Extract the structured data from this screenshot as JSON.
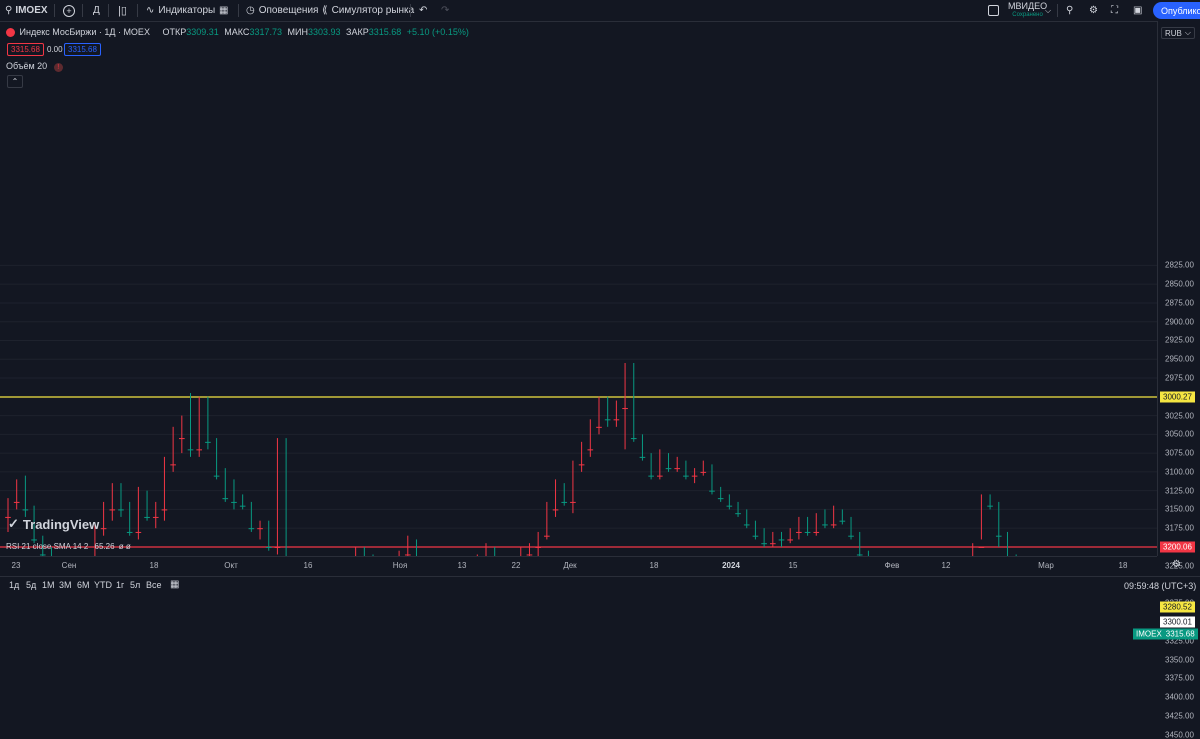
{
  "toolbar": {
    "symbol": "IMOEX",
    "interval": "Д",
    "indicators_label": "Индикаторы",
    "alerts_label": "Оповещения",
    "replay_label": "Симулятор рынка",
    "layout_name": "МВИДЕО",
    "layout_status": "Сохранено",
    "publish_label": "Опубликов"
  },
  "legend": {
    "title": "Индекс МосБиржи · 1Д · MOEX",
    "open_label": "ОТКР",
    "open": "3309.31",
    "high_label": "МАКС",
    "high": "3317.73",
    "low_label": "МИН",
    "low": "3303.93",
    "close_label": "ЗАКР",
    "close": "3315.68",
    "change": "+5.10 (+0.15%)",
    "bid": "3315.68",
    "spread": "0.00",
    "ask": "3315.68",
    "volume_label": "Объём 20"
  },
  "currency": "RUB",
  "price_axis": [
    "3450.00",
    "3425.00",
    "3400.00",
    "3375.00",
    "3350.00",
    "3325.00",
    "3275.00",
    "3250.00",
    "3225.00",
    "3175.00",
    "3150.00",
    "3125.00",
    "3100.00",
    "3075.00",
    "3050.00",
    "3025.00",
    "2975.00",
    "2950.00",
    "2925.00",
    "2900.00",
    "2875.00",
    "2850.00",
    "2825.00"
  ],
  "time_axis": [
    "23",
    "Сен",
    "18",
    "Окт",
    "16",
    "Ноя",
    "13",
    "22",
    "Дек",
    "18",
    "2024",
    "15",
    "Фев",
    "12",
    "Мар",
    "18"
  ],
  "levels": [
    {
      "value": "3300.01",
      "color": "#ffffff"
    },
    {
      "value": "3280.52",
      "color": "#f5e642"
    },
    {
      "value": "3200.06",
      "color": "#f23645"
    },
    {
      "value": "3000.27",
      "color": "#f5e642"
    }
  ],
  "last_price": {
    "symbol": "IMOEX",
    "value": "3315.68",
    "color": "#089981"
  },
  "watermark": "TradingView",
  "rsi": {
    "label": "RSI 21 close SMA 14 2",
    "value": "65.26",
    "extra": "ø ø"
  },
  "timeframes": [
    "1д",
    "5д",
    "1M",
    "3M",
    "6M",
    "YTD",
    "1г",
    "5л",
    "Все"
  ],
  "clock": "09:59:48 (UTC+3)",
  "colors": {
    "up": "#089981",
    "down": "#f23645",
    "background": "#131722",
    "accent": "#2962ff"
  },
  "chart_data": {
    "type": "candlestick",
    "unit": "RUB",
    "ylim": [
      2810,
      3480
    ],
    "candles": [
      [
        3160,
        3180,
        3135,
        3140
      ],
      [
        3140,
        3150,
        3110,
        3115
      ],
      [
        3115,
        3160,
        3105,
        3150
      ],
      [
        3150,
        3195,
        3145,
        3190
      ],
      [
        3190,
        3215,
        3185,
        3210
      ],
      [
        3210,
        3225,
        3200,
        3220
      ],
      [
        3220,
        3235,
        3215,
        3230
      ],
      [
        3230,
        3275,
        3225,
        3270
      ],
      [
        3270,
        3285,
        3245,
        3255
      ],
      [
        3255,
        3270,
        3240,
        3260
      ],
      [
        3260,
        3265,
        3170,
        3175
      ],
      [
        3175,
        3185,
        3140,
        3150
      ],
      [
        3150,
        3165,
        3115,
        3125
      ],
      [
        3125,
        3160,
        3115,
        3150
      ],
      [
        3150,
        3185,
        3140,
        3180
      ],
      [
        3180,
        3190,
        3120,
        3130
      ],
      [
        3130,
        3165,
        3125,
        3160
      ],
      [
        3160,
        3175,
        3140,
        3150
      ],
      [
        3150,
        3165,
        3080,
        3090
      ],
      [
        3090,
        3100,
        3040,
        3055
      ],
      [
        3055,
        3075,
        3025,
        3030
      ],
      [
        3030,
        3080,
        2995,
        3070
      ],
      [
        3070,
        3080,
        3000,
        3010
      ],
      [
        3010,
        3070,
        3000,
        3060
      ],
      [
        3060,
        3110,
        3055,
        3105
      ],
      [
        3105,
        3140,
        3095,
        3135
      ],
      [
        3135,
        3150,
        3110,
        3140
      ],
      [
        3140,
        3150,
        3130,
        3145
      ],
      [
        3145,
        3180,
        3140,
        3175
      ],
      [
        3175,
        3190,
        3165,
        3170
      ],
      [
        3170,
        3205,
        3165,
        3200
      ],
      [
        3200,
        3210,
        3055,
        3060
      ],
      [
        3060,
        3235,
        3055,
        3225
      ],
      [
        3225,
        3250,
        3215,
        3245
      ],
      [
        3245,
        3260,
        3235,
        3255
      ],
      [
        3255,
        3265,
        3245,
        3250
      ],
      [
        3250,
        3275,
        3245,
        3270
      ],
      [
        3270,
        3280,
        3255,
        3265
      ],
      [
        3265,
        3275,
        3250,
        3260
      ],
      [
        3260,
        3270,
        3240,
        3245
      ],
      [
        3245,
        3250,
        3200,
        3210
      ],
      [
        3210,
        3225,
        3200,
        3220
      ],
      [
        3220,
        3235,
        3210,
        3230
      ],
      [
        3230,
        3245,
        3225,
        3240
      ],
      [
        3240,
        3250,
        3230,
        3235
      ],
      [
        3235,
        3245,
        3205,
        3210
      ],
      [
        3210,
        3215,
        3185,
        3195
      ],
      [
        3195,
        3230,
        3190,
        3225
      ],
      [
        3225,
        3250,
        3220,
        3245
      ],
      [
        3245,
        3255,
        3240,
        3250
      ],
      [
        3250,
        3265,
        3240,
        3245
      ],
      [
        3245,
        3260,
        3235,
        3255
      ],
      [
        3255,
        3265,
        3245,
        3250
      ],
      [
        3250,
        3260,
        3225,
        3230
      ],
      [
        3230,
        3240,
        3210,
        3215
      ],
      [
        3215,
        3225,
        3195,
        3205
      ],
      [
        3205,
        3235,
        3200,
        3230
      ],
      [
        3230,
        3245,
        3225,
        3240
      ],
      [
        3240,
        3245,
        3220,
        3225
      ],
      [
        3225,
        3235,
        3200,
        3210
      ],
      [
        3210,
        3225,
        3195,
        3200
      ],
      [
        3200,
        3215,
        3180,
        3185
      ],
      [
        3185,
        3190,
        3140,
        3150
      ],
      [
        3150,
        3160,
        3110,
        3120
      ],
      [
        3120,
        3145,
        3115,
        3140
      ],
      [
        3140,
        3155,
        3085,
        3090
      ],
      [
        3090,
        3100,
        3060,
        3070
      ],
      [
        3070,
        3080,
        3030,
        3040
      ],
      [
        3040,
        3050,
        3000,
        3010
      ],
      [
        3010,
        3040,
        3000,
        3030
      ],
      [
        3030,
        3040,
        3005,
        3015
      ],
      [
        3015,
        3070,
        2955,
        2960
      ],
      [
        2960,
        3060,
        2955,
        3055
      ],
      [
        3055,
        3085,
        3050,
        3080
      ],
      [
        3080,
        3110,
        3075,
        3105
      ],
      [
        3105,
        3110,
        3070,
        3080
      ],
      [
        3080,
        3100,
        3075,
        3095
      ],
      [
        3095,
        3100,
        3080,
        3090
      ],
      [
        3090,
        3110,
        3085,
        3105
      ],
      [
        3105,
        3115,
        3095,
        3100
      ],
      [
        3100,
        3105,
        3085,
        3095
      ],
      [
        3095,
        3130,
        3090,
        3125
      ],
      [
        3125,
        3140,
        3120,
        3135
      ],
      [
        3135,
        3150,
        3130,
        3145
      ],
      [
        3145,
        3160,
        3140,
        3155
      ],
      [
        3155,
        3175,
        3150,
        3170
      ],
      [
        3170,
        3190,
        3165,
        3185
      ],
      [
        3185,
        3200,
        3175,
        3195
      ],
      [
        3195,
        3200,
        3180,
        3185
      ],
      [
        3185,
        3200,
        3180,
        3190
      ],
      [
        3190,
        3195,
        3175,
        3180
      ],
      [
        3180,
        3190,
        3160,
        3165
      ],
      [
        3165,
        3185,
        3160,
        3180
      ],
      [
        3180,
        3185,
        3155,
        3160
      ],
      [
        3160,
        3175,
        3150,
        3170
      ],
      [
        3170,
        3175,
        3145,
        3155
      ],
      [
        3155,
        3170,
        3150,
        3165
      ],
      [
        3165,
        3190,
        3160,
        3185
      ],
      [
        3185,
        3215,
        3180,
        3210
      ],
      [
        3210,
        3230,
        3205,
        3225
      ],
      [
        3225,
        3235,
        3215,
        3230
      ],
      [
        3230,
        3240,
        3220,
        3225
      ],
      [
        3225,
        3250,
        3220,
        3245
      ],
      [
        3245,
        3265,
        3240,
        3260
      ],
      [
        3260,
        3265,
        3235,
        3240
      ],
      [
        3240,
        3255,
        3230,
        3250
      ],
      [
        3250,
        3260,
        3240,
        3255
      ],
      [
        3255,
        3265,
        3245,
        3250
      ],
      [
        3250,
        3275,
        3245,
        3270
      ],
      [
        3270,
        3275,
        3240,
        3245
      ],
      [
        3245,
        3250,
        3220,
        3225
      ],
      [
        3225,
        3230,
        3195,
        3200
      ],
      [
        3200,
        3190,
        3130,
        3140
      ],
      [
        3140,
        3150,
        3130,
        3145
      ],
      [
        3145,
        3200,
        3140,
        3185
      ],
      [
        3185,
        3220,
        3180,
        3215
      ],
      [
        3215,
        3230,
        3210,
        3225
      ],
      [
        3225,
        3240,
        3220,
        3235
      ],
      [
        3235,
        3265,
        3230,
        3260
      ],
      [
        3260,
        3280,
        3255,
        3275
      ],
      [
        3275,
        3300,
        3270,
        3295
      ],
      [
        3295,
        3312,
        3290,
        3305
      ],
      [
        3305,
        3315,
        3295,
        3310
      ],
      [
        3309.31,
        3317.73,
        3303.93,
        3315.68
      ]
    ]
  }
}
